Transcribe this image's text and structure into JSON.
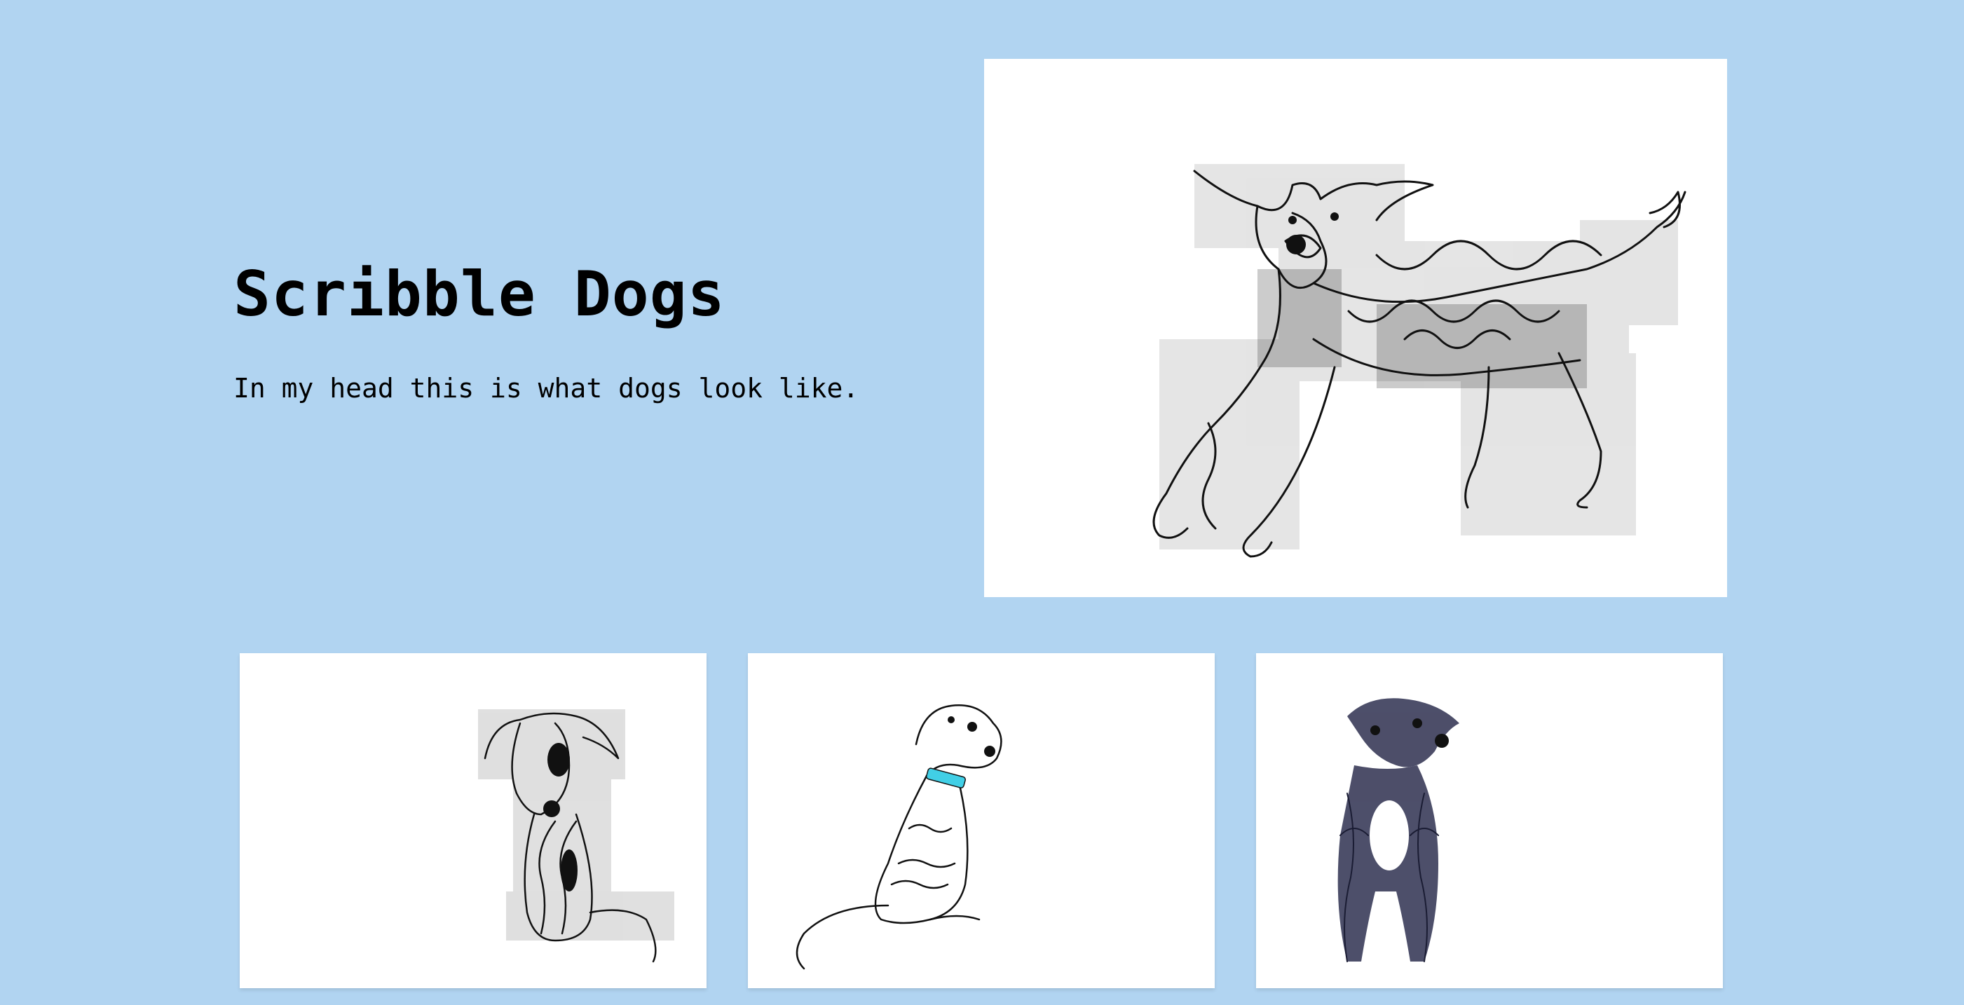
{
  "page": {
    "background_color": "#b1d4f1"
  },
  "hero": {
    "title": "Scribble Dogs",
    "subtitle": "In my head this is what dogs look like."
  },
  "gallery": {
    "featured_image": {
      "icon": "running-dog-icon"
    },
    "thumbnails": [
      {
        "icon": "sitting-dog-patched-icon"
      },
      {
        "icon": "sitting-dog-collar-icon",
        "collar_color": "#41cfe6"
      },
      {
        "icon": "standing-dog-icon",
        "ink_color": "#2e3050"
      }
    ]
  }
}
